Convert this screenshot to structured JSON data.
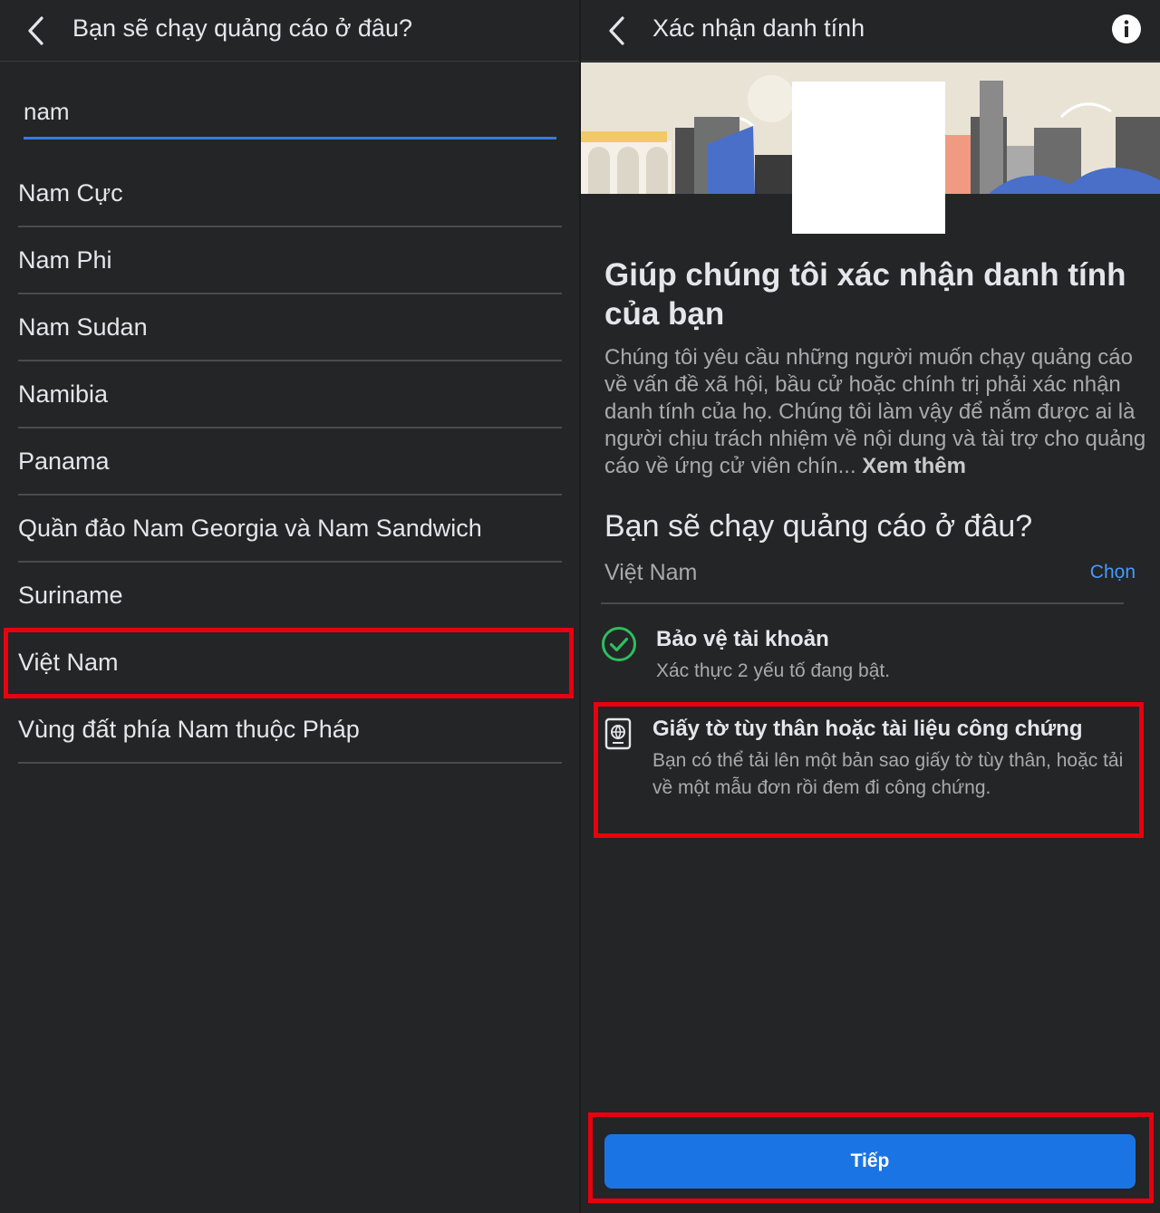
{
  "left_panel": {
    "header_title": "Bạn sẽ chạy quảng cáo ở đâu?",
    "search_value": "nam",
    "countries": [
      "Nam Cực",
      "Nam Phi",
      "Nam Sudan",
      "Namibia",
      "Panama",
      "Quần đảo Nam Georgia và Nam Sandwich",
      "Suriname",
      "Việt Nam",
      "Vùng đất phía Nam thuộc Pháp"
    ],
    "highlighted_country": "Việt Nam"
  },
  "right_panel": {
    "header_title": "Xác nhận danh tính",
    "main_title": "Giúp chúng tôi xác nhận danh tính của bạn",
    "description": "Chúng tôi yêu cầu những người muốn chạy quảng cáo về vấn đề xã hội, bầu cử hoặc chính trị phải xác nhận danh tính của họ. Chúng tôi làm vậy để nắm được ai là người chịu trách nhiệm về nội dung và tài trợ cho quảng cáo về ứng cử viên chín...",
    "see_more": "Xem thêm",
    "question": "Bạn sẽ chạy quảng cáo ở đâu?",
    "selected_country": "Việt Nam",
    "choose_label": "Chọn",
    "steps": [
      {
        "title": "Bảo vệ tài khoản",
        "subtitle": "Xác thực 2 yếu tố đang bật.",
        "icon": "check-circle-icon"
      },
      {
        "title": "Giấy tờ tùy thân hoặc tài liệu công chứng",
        "subtitle": "Bạn có thể tải lên một bản sao giấy tờ tùy thân, hoặc tải về một mẫu đơn rồi đem đi công chứng.",
        "icon": "passport-icon"
      }
    ],
    "next_button": "Tiếp"
  },
  "colors": {
    "background": "#242526",
    "accent_blue": "#1b74e4",
    "link_blue": "#4599ff",
    "highlight_red": "#e8000e",
    "success_green": "#2dbe60"
  }
}
